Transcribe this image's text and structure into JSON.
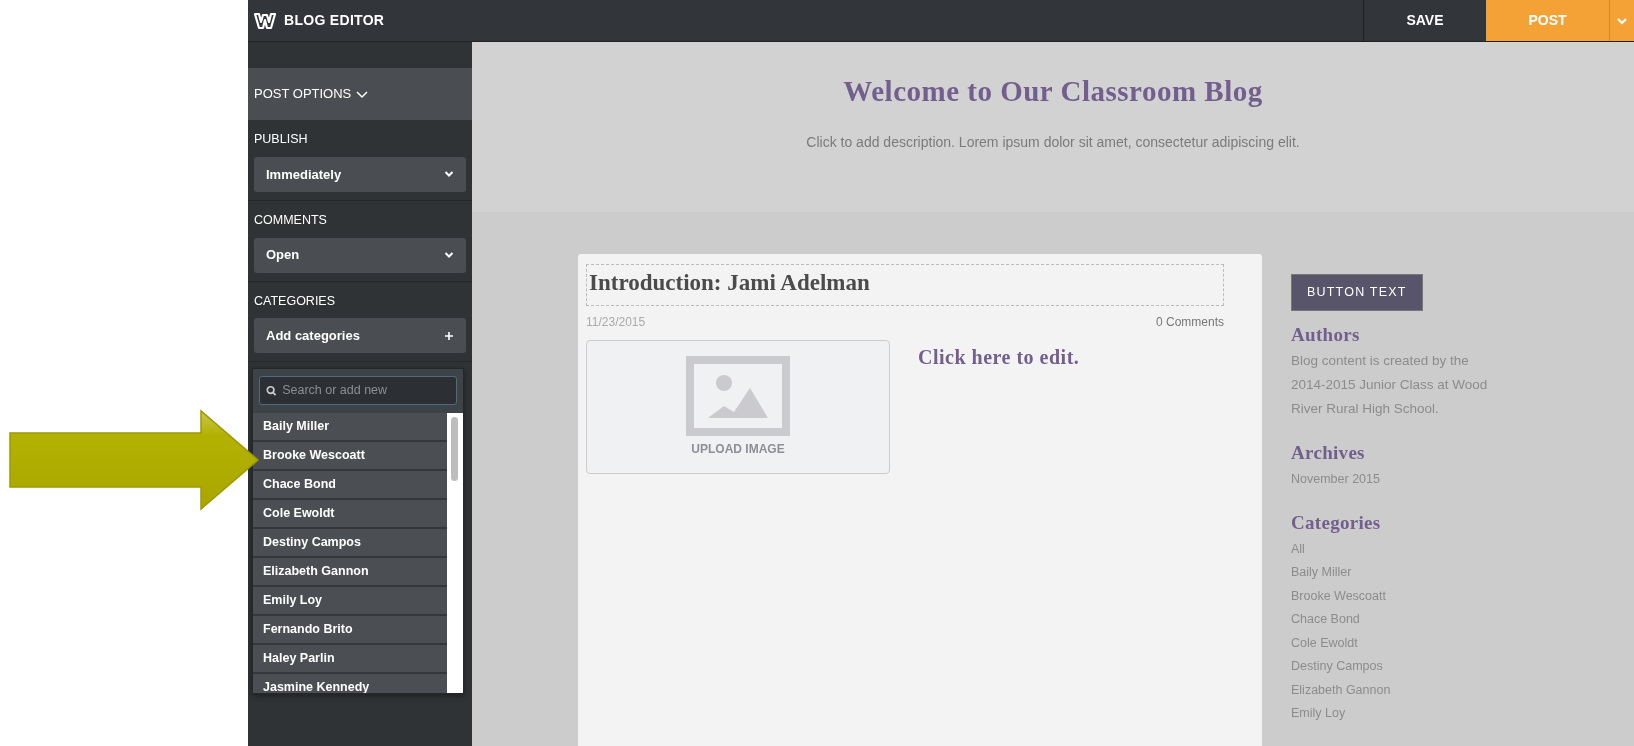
{
  "topbar": {
    "title": "BLOG EDITOR",
    "buttons": [
      {
        "label": "SAVE",
        "kind": "save"
      },
      {
        "label": "POST",
        "kind": "post"
      }
    ]
  },
  "sidebar": {
    "section_title": "POST OPTIONS",
    "fields": [
      {
        "label": "PUBLISH",
        "value": "Immediately",
        "kind": "select"
      },
      {
        "label": "COMMENTS",
        "value": "Open",
        "kind": "select"
      },
      {
        "label": "CATEGORIES",
        "value": "Add categories",
        "kind": "add"
      }
    ],
    "category_dropdown": {
      "search": {
        "placeholder": "Search or add new"
      },
      "items": [
        "Baily Miller",
        "Brooke Wescoatt",
        "Chace Bond",
        "Cole Ewoldt",
        "Destiny Campos",
        "Elizabeth Gannon",
        "Emily Loy",
        "Fernando Brito",
        "Haley Parlin",
        "Jasmine Kennedy"
      ]
    }
  },
  "blog": {
    "title": "Welcome to Our Classroom Blog",
    "description": "Click to add description. Lorem ipsum dolor sit amet, consectetur adipiscing elit.",
    "post": {
      "title": "Introduction: Jami Adelman",
      "date": "11/23/2015",
      "comments": "0 Comments",
      "image_label": "UPLOAD IMAGE",
      "body": "Click here to edit."
    },
    "side": {
      "button": "BUTTON TEXT",
      "sections": [
        {
          "heading": "Authors",
          "kind": "text",
          "text": "Blog content is created by the 2014-2015 Junior Class at Wood River Rural High School."
        },
        {
          "heading": "Archives",
          "kind": "links",
          "items": [
            "November 2015"
          ]
        },
        {
          "heading": "Categories",
          "kind": "links",
          "items": [
            "All",
            "Baily Miller",
            "Brooke Wescoatt",
            "Chace Bond",
            "Cole Ewoldt",
            "Destiny Campos",
            "Elizabeth Gannon",
            "Emily Loy"
          ]
        }
      ]
    }
  }
}
